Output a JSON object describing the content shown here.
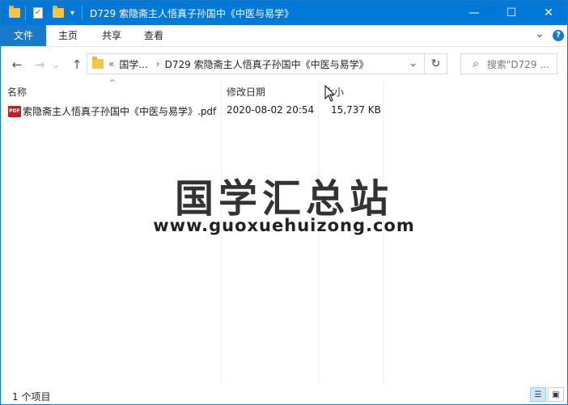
{
  "window": {
    "title": "D729 索隐斋主人悟真子孙国中《中医与易学》",
    "quick_access_dropdown": "▾"
  },
  "window_controls": {
    "minimize": "—",
    "maximize": "☐",
    "close": "✕"
  },
  "ribbon": {
    "tabs": [
      "文件",
      "主页",
      "共享",
      "查看"
    ],
    "expand_glyph": "⌄",
    "help_glyph": "?"
  },
  "nav": {
    "back": "←",
    "forward": "→",
    "recent": "⌄",
    "up": "↑",
    "address": {
      "overflow": "«",
      "seg1": "国学...",
      "sep": "›",
      "seg2": "D729 索隐斋主人悟真子孙国中《中医与易学》",
      "dropdown": "⌄"
    },
    "refresh": "↻",
    "search_placeholder": "搜索\"D729 ..."
  },
  "columns": {
    "name": "名称",
    "date": "修改日期",
    "size": "大小",
    "sort_glyph": "^"
  },
  "files": [
    {
      "icon_label": "PDF",
      "name": "索隐斋主人悟真子孙国中《中医与易学》.pdf",
      "date": "2020-08-02 20:54",
      "size": "15,737 KB"
    }
  ],
  "watermark": {
    "line1": "国学汇总站",
    "line2": "www.guoxuehuizong.com"
  },
  "status": {
    "text": "1 个项目"
  },
  "icons": {
    "search": "⌕"
  },
  "colors": {
    "titlebar": "#0078d7",
    "file_tab": "#1979ca",
    "pdf_icon": "#c21f1f"
  }
}
